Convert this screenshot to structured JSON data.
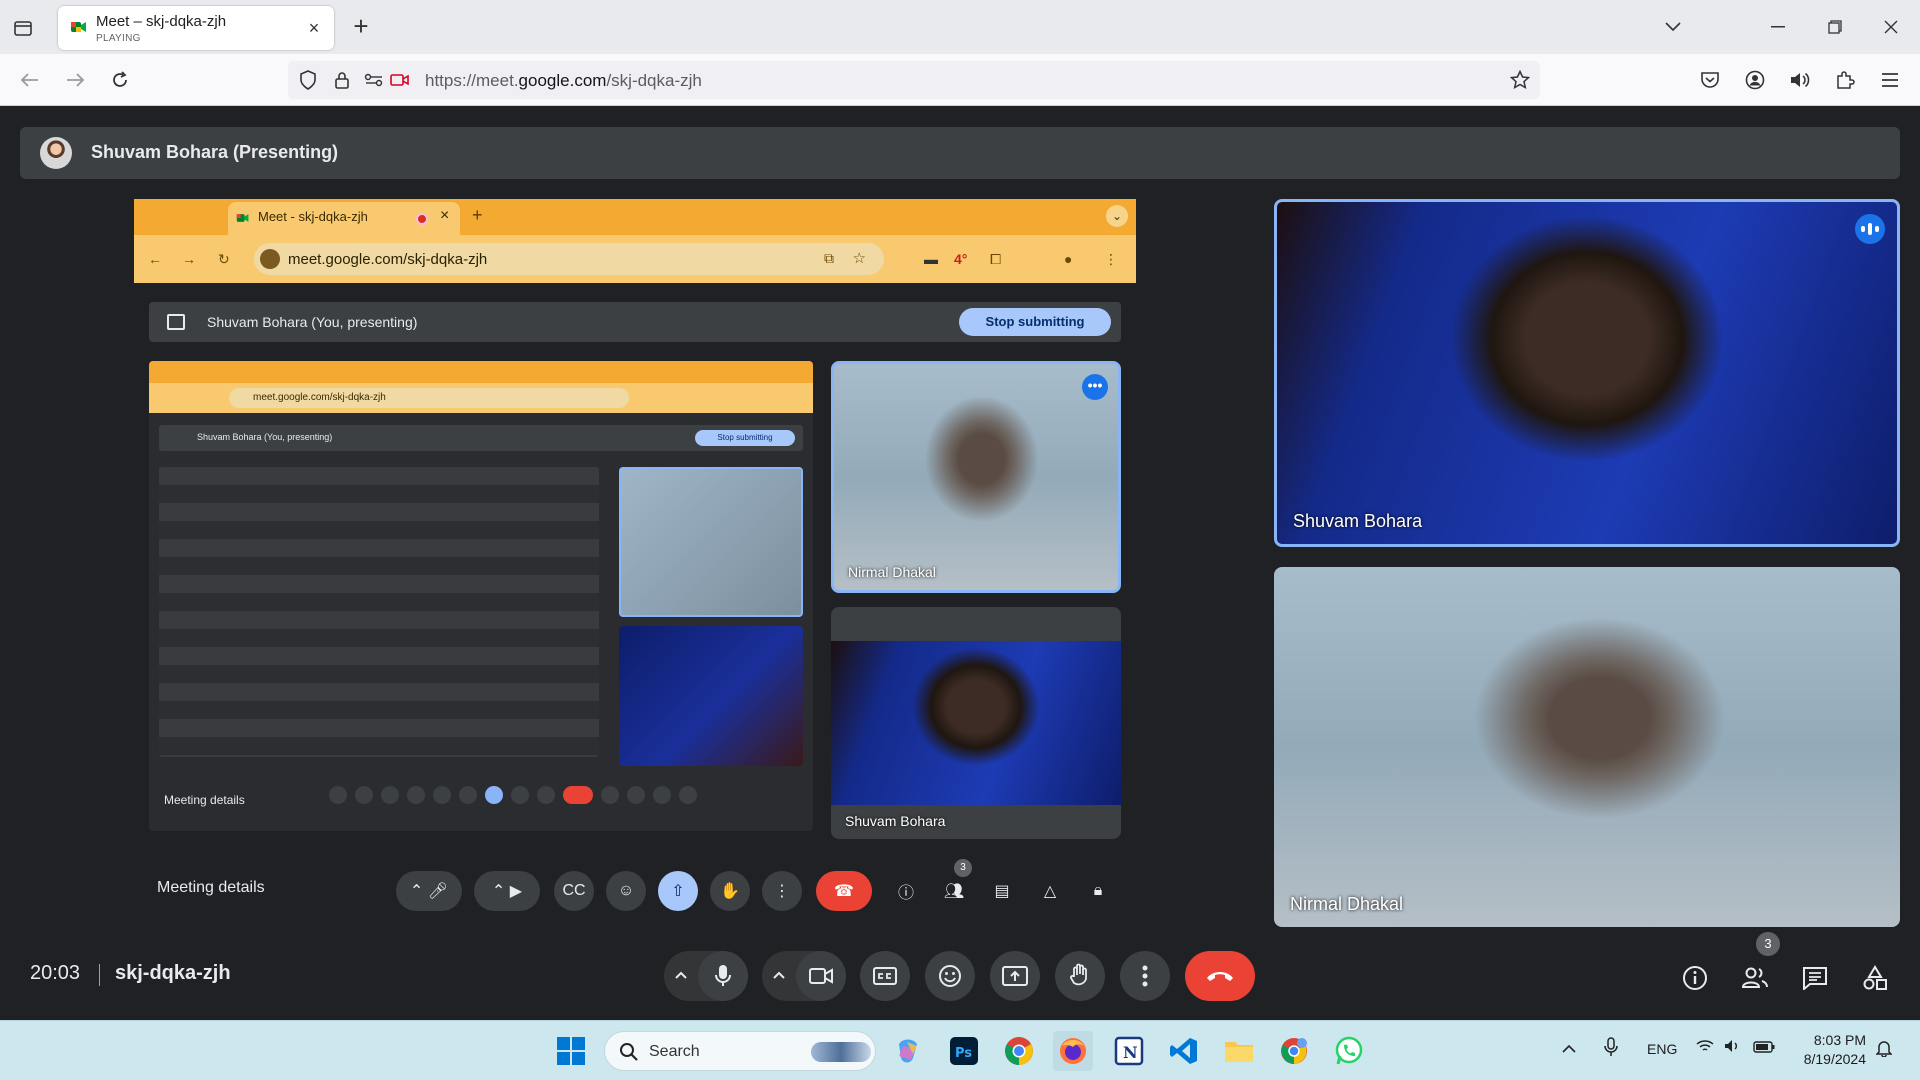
{
  "browser": {
    "tab": {
      "title": "Meet – skj-dqka-zjh",
      "subtitle": "PLAYING",
      "close": "×"
    },
    "new_tab": "+",
    "url_prefix": "https://meet.",
    "url_domain": "google.com",
    "url_path": "/skj-dqka-zjh"
  },
  "meet": {
    "presenter_title": "Shuvam Bohara (Presenting)",
    "clock": "20:03",
    "meeting_code": "skj-dqka-zjh",
    "people_count": "3",
    "participants": [
      {
        "name": "Shuvam Bohara"
      },
      {
        "name": "Nirmal Dhakal"
      }
    ],
    "colors": {
      "end_call": "#ea4335",
      "active_border": "#8ab4f8",
      "speaking": "#1a73e8"
    }
  },
  "shared_screen": {
    "tab_title": "Meet - skj-dqka-zjh",
    "tab_close": "×",
    "new_tab": "+",
    "url": "meet.google.com/skj-dqka-zjh",
    "temp": "4°",
    "presenting_text": "Shuvam Bohara (You, presenting)",
    "stop_button": "Stop submitting",
    "meeting_details": "Meeting details",
    "people_count": "3",
    "nested_url": "meet.google.com/skj-dqka-zjh",
    "nested_presenting": "Shuvam Bohara (You, presenting)",
    "nested_stop": "Stop submitting",
    "nested_meeting_details": "Meeting details",
    "tile_nirmal": "Nirmal Dhakal",
    "tile_shuvam": "Shuvam Bohara"
  },
  "taskbar": {
    "search_placeholder": "Search",
    "language": "ENG",
    "time": "8:03 PM",
    "date": "8/19/2024"
  }
}
